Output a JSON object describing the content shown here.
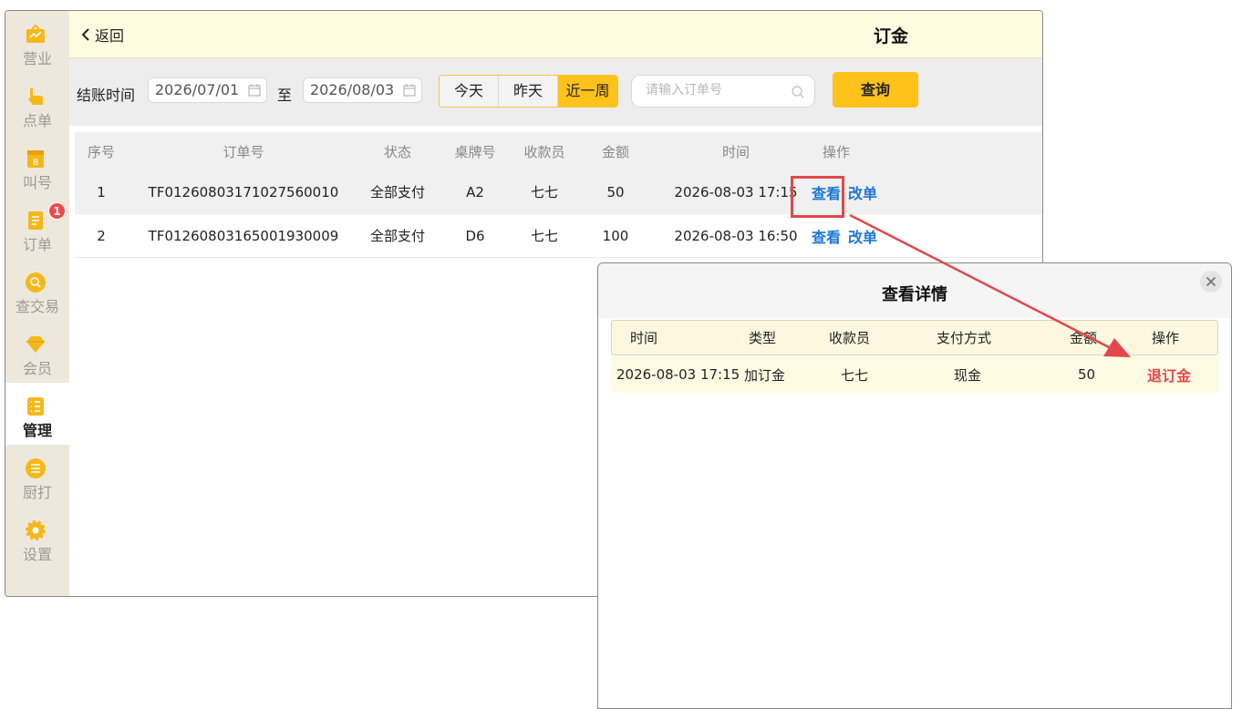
{
  "sidebar": {
    "items": [
      {
        "label": "营业",
        "icon": "bag-icon"
      },
      {
        "label": "点单",
        "icon": "hand-icon"
      },
      {
        "label": "叫号",
        "icon": "number-icon"
      },
      {
        "label": "订单",
        "icon": "order-icon",
        "badge": "1"
      },
      {
        "label": "查交易",
        "icon": "search-icon"
      },
      {
        "label": "会员",
        "icon": "diamond-icon"
      },
      {
        "label": "管理",
        "icon": "list-icon",
        "active": true
      },
      {
        "label": "厨打",
        "icon": "menu-icon"
      },
      {
        "label": "设置",
        "icon": "gear-icon"
      }
    ]
  },
  "header": {
    "back_label": "返回",
    "title": "订金"
  },
  "filter": {
    "label": "结账时间",
    "date_from": "2026/07/01",
    "to_label": "至",
    "date_to": "2026/08/03",
    "ranges": [
      "今天",
      "昨天",
      "近一周"
    ],
    "active_range": "近一周",
    "search_placeholder": "请输入订单号",
    "query_label": "查询"
  },
  "table": {
    "headers": [
      "序号",
      "订单号",
      "状态",
      "桌牌号",
      "收款员",
      "金额",
      "时间",
      "操作"
    ],
    "rows": [
      {
        "no": "1",
        "order": "TF01260803171027560010",
        "status": "全部支付",
        "table": "A2",
        "cashier": "七七",
        "amount": "50",
        "time": "2026-08-03 17:15",
        "view": "查看",
        "edit": "改单"
      },
      {
        "no": "2",
        "order": "TF01260803165001930009",
        "status": "全部支付",
        "table": "D6",
        "cashier": "七七",
        "amount": "100",
        "time": "2026-08-03 16:50",
        "view": "查看",
        "edit": "改单"
      }
    ]
  },
  "modal": {
    "title": "查看详情",
    "headers": [
      "时间",
      "类型",
      "收款员",
      "支付方式",
      "金额",
      "操作"
    ],
    "rows": [
      {
        "time": "2026-08-03 17:15",
        "type": "加订金",
        "cashier": "七七",
        "pay": "现金",
        "amount": "50",
        "action": "退订金"
      }
    ]
  },
  "colors": {
    "accent": "#ffc21a",
    "link": "#1e78d4",
    "danger": "#e5484d",
    "annotation": "#e2474b"
  }
}
